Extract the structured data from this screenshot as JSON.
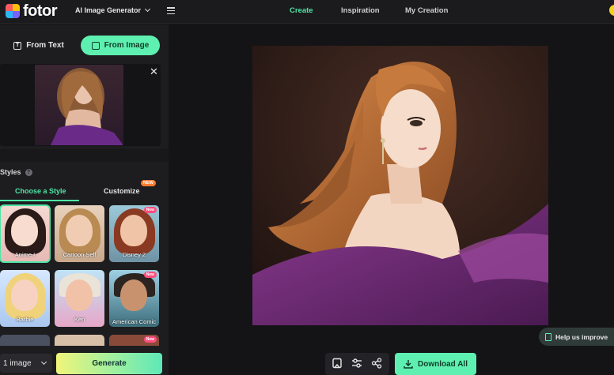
{
  "header": {
    "logo_text": "fotor",
    "tool_select": "AI Image Generator",
    "nav": [
      {
        "label": "Create",
        "active": true
      },
      {
        "label": "Inspiration",
        "active": false
      },
      {
        "label": "My Creation",
        "active": false
      }
    ]
  },
  "left_panel": {
    "mode_tabs": [
      {
        "label": "From Text",
        "active": false
      },
      {
        "label": "From Image",
        "active": true
      }
    ],
    "close_symbol": "✕",
    "styles_heading": "Styles",
    "style_tabs": [
      {
        "label": "Choose a Style",
        "active": true
      },
      {
        "label": "Customize",
        "badge": "NEW",
        "active": false
      }
    ],
    "styles": [
      {
        "label": "Anime I",
        "selected": true,
        "new": false
      },
      {
        "label": "Cartoon Self",
        "selected": false,
        "new": false
      },
      {
        "label": "Disney 2",
        "selected": false,
        "new": true
      },
      {
        "label": "Barbie",
        "selected": false,
        "new": false
      },
      {
        "label": "Ken",
        "selected": false,
        "new": false
      },
      {
        "label": "American Comic",
        "selected": false,
        "new": true
      }
    ],
    "new_badge": "New",
    "image_count": "1 image",
    "generate_label": "Generate"
  },
  "main": {
    "download_label": "Download All",
    "help_label": "Help us improve"
  },
  "colors": {
    "accent": "#5ef0b0",
    "background": "#141416",
    "panel": "#1d1d20"
  }
}
